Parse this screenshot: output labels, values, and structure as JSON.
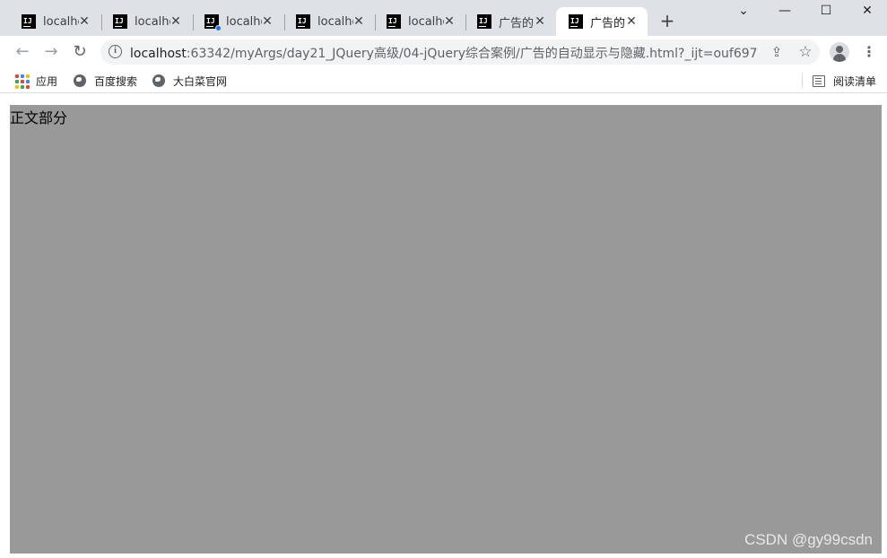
{
  "tabs": [
    {
      "title": "localhost",
      "icon": "intellij-icon",
      "loading": false
    },
    {
      "title": "localhost",
      "icon": "intellij-icon",
      "loading": false
    },
    {
      "title": "localhost",
      "icon": "intellij-icon",
      "loading": true
    },
    {
      "title": "localhost",
      "icon": "intellij-icon",
      "loading": false
    },
    {
      "title": "localhost",
      "icon": "intellij-icon",
      "loading": false
    },
    {
      "title": "广告的",
      "icon": "intellij-icon",
      "loading": false
    },
    {
      "title": "广告的",
      "icon": "intellij-icon",
      "loading": false,
      "active": true
    }
  ],
  "tab_close_glyph": "✕",
  "newtab_glyph": "+",
  "window_controls": {
    "collapse": "⌄",
    "minimize": "—",
    "maximize": "☐",
    "close": "✕"
  },
  "toolbar": {
    "back": "←",
    "forward": "→",
    "reload": "↻",
    "url_host": "localhost",
    "url_rest": ":63342/myArgs/day21_JQuery高级/04-jQuery综合案例/广告的自动显示与隐藏.html?_ijt=ouf697...",
    "menu": "⋮"
  },
  "bookmarks": [
    {
      "label": "应用",
      "icon": "apps-grid-icon"
    },
    {
      "label": "百度搜索",
      "icon": "globe-icon"
    },
    {
      "label": "大白菜官网",
      "icon": "globe-icon"
    }
  ],
  "reading_list": "阅读清单",
  "content": {
    "body_text": "正文部分",
    "ad_box_color": "#999999"
  },
  "watermark": "CSDN @gy99csdn",
  "colors": {
    "tabstrip": "#dee1e6",
    "omnibox": "#f1f3f4",
    "loading_dot": "#1a73e8"
  }
}
